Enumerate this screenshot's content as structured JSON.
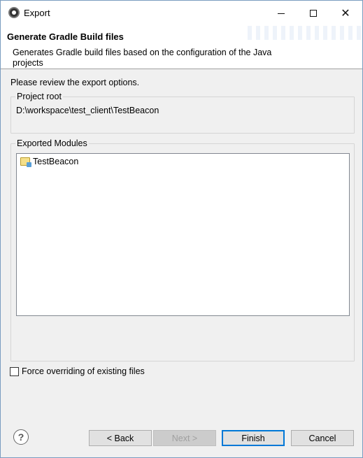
{
  "window": {
    "title": "Export",
    "icon": "eclipse-gear-icon",
    "controls": {
      "minimize": "minimize-icon",
      "maximize": "maximize-icon",
      "close_glyph": "✕"
    }
  },
  "banner": {
    "title": "Generate Gradle Build files",
    "description": "Generates Gradle build files based on the configuration of the Java projects"
  },
  "review_label": "Please review the export options.",
  "project_root": {
    "legend": "Project root",
    "path": "D:\\workspace\\test_client\\TestBeacon"
  },
  "exported_modules": {
    "legend": "Exported Modules",
    "items": [
      {
        "label": "TestBeacon",
        "icon": "project-folder-icon"
      }
    ]
  },
  "force_override": {
    "label": "Force overriding of existing files",
    "checked": false
  },
  "buttons": {
    "help": "?",
    "back": "< Back",
    "next": "Next >",
    "finish": "Finish",
    "cancel": "Cancel"
  },
  "colors": {
    "accent": "#0078d7",
    "disabled_text": "#a0a0a0"
  }
}
